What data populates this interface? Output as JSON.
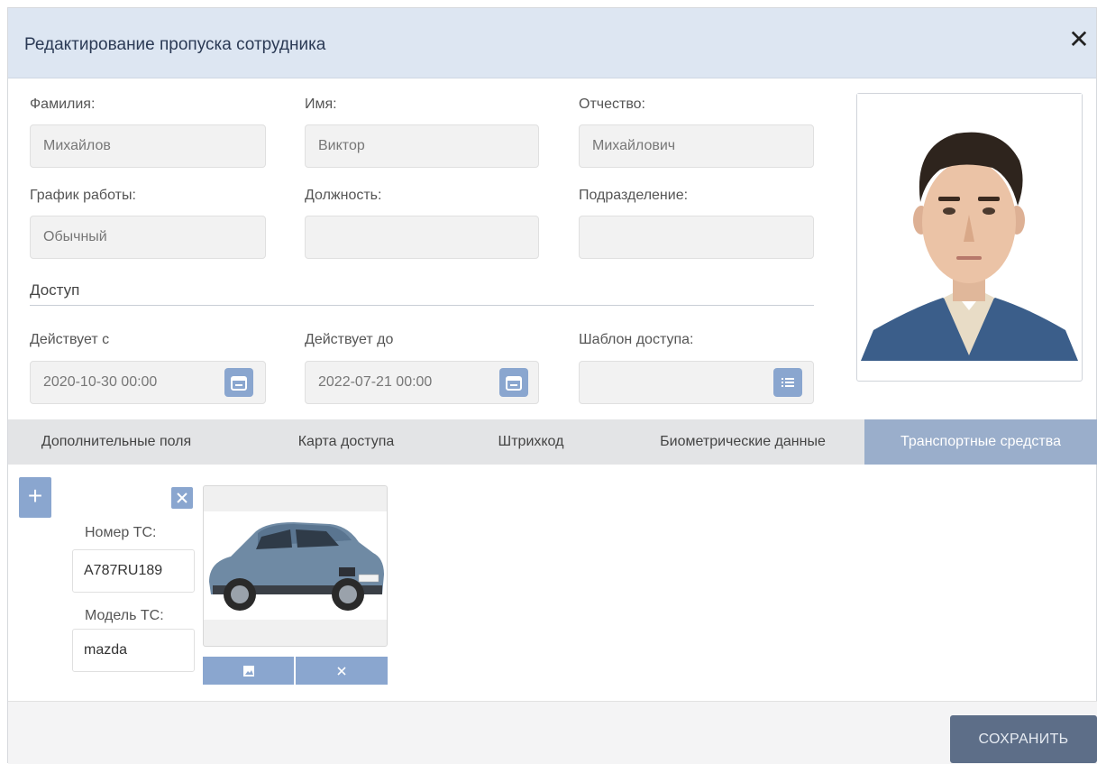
{
  "dialog": {
    "title": "Редактирование пропуска сотрудника",
    "close": "✕"
  },
  "form": {
    "last_name": {
      "label": "Фамилия:",
      "value": "Михайлов"
    },
    "first_name": {
      "label": "Имя:",
      "value": "Виктор"
    },
    "patronymic": {
      "label": "Отчество:",
      "value": "Михайлович"
    },
    "schedule": {
      "label": "График работы:",
      "value": "Обычный"
    },
    "position": {
      "label": "Должность:",
      "value": ""
    },
    "department": {
      "label": "Подразделение:",
      "value": ""
    }
  },
  "access": {
    "section_title": "Доступ",
    "valid_from": {
      "label": "Действует с",
      "value": "2020-10-30 00:00"
    },
    "valid_to": {
      "label": "Действует до",
      "value": "2022-07-21 00:00"
    },
    "template": {
      "label": "Шаблон доступа:",
      "value": ""
    }
  },
  "tabs": [
    {
      "label": "Дополнительные поля",
      "active": false
    },
    {
      "label": "Карта доступа",
      "active": false
    },
    {
      "label": "Штрихкод",
      "active": false
    },
    {
      "label": "Биометрические данные",
      "active": false
    },
    {
      "label": "Транспортные средства",
      "active": true
    }
  ],
  "vehicle": {
    "add": "+",
    "plate": {
      "label": "Номер ТС:",
      "value": "A787RU189"
    },
    "model": {
      "label": "Модель ТС:",
      "value": "mazda"
    }
  },
  "footer": {
    "save": "СОХРАНИТЬ"
  },
  "colors": {
    "accent": "#8aa6cf",
    "header_bg": "#dde6f2",
    "tab_active": "#9aaecb",
    "save_bg": "#5d6e88"
  }
}
